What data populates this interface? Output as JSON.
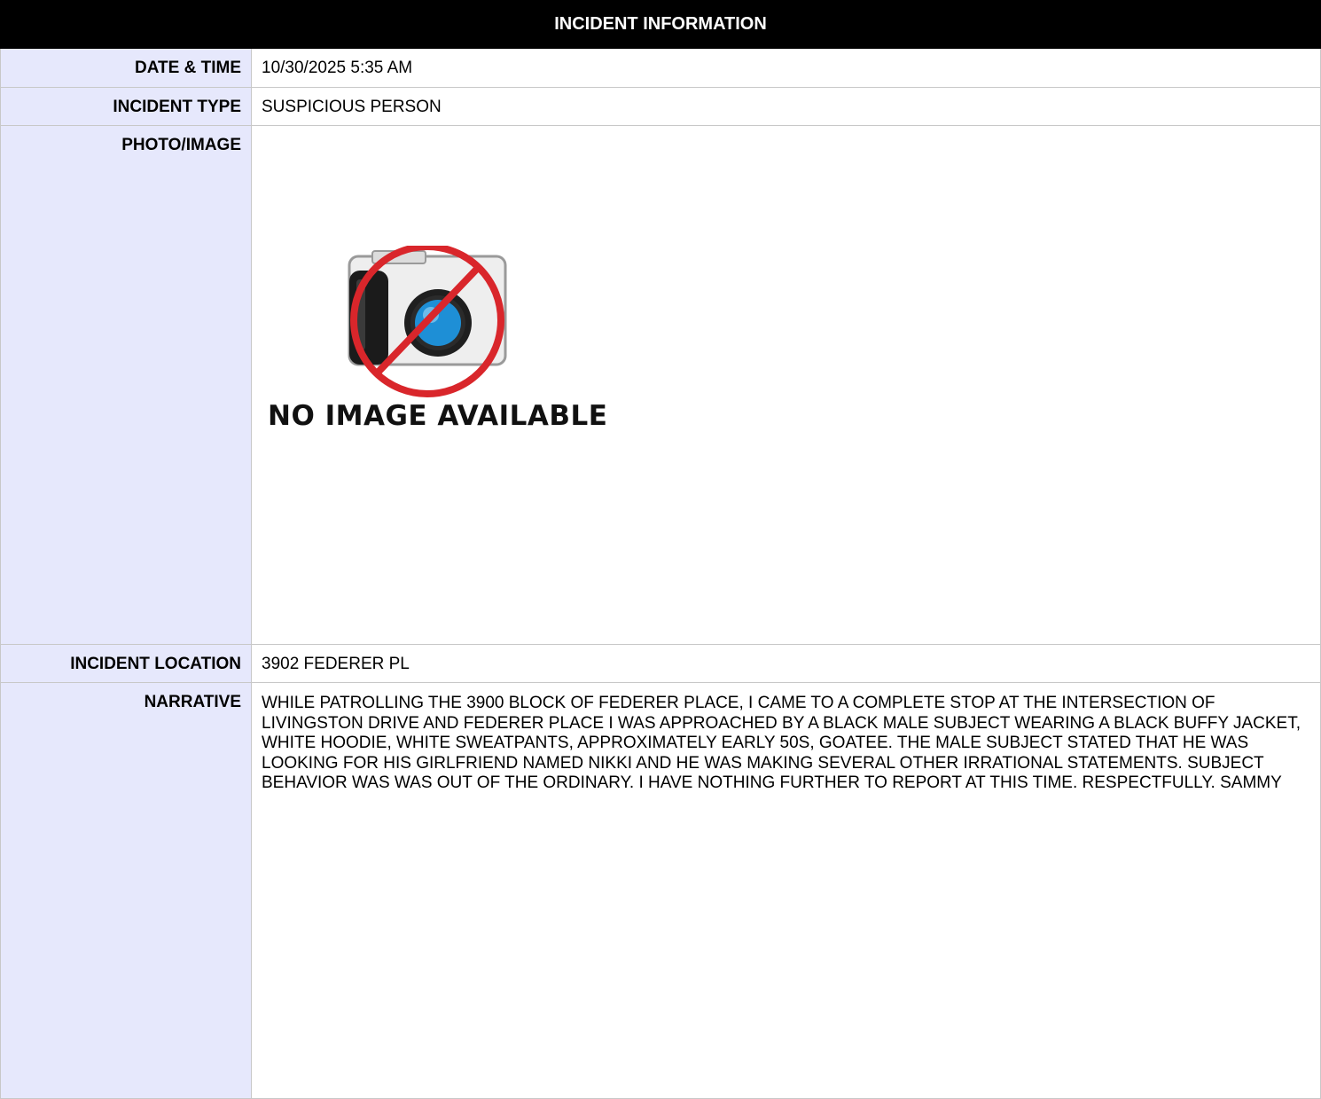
{
  "header": {
    "title": "INCIDENT INFORMATION"
  },
  "rows": {
    "date_time": {
      "label": "DATE & TIME",
      "value": "10/30/2025 5:35 AM"
    },
    "incident_type": {
      "label": "INCIDENT TYPE",
      "value": "SUSPICIOUS PERSON"
    },
    "photo": {
      "label": "PHOTO/IMAGE",
      "placeholder_text": "NO IMAGE AVAILABLE",
      "placeholder_icon": "no-camera-icon"
    },
    "location": {
      "label": "INCIDENT LOCATION",
      "value": "3902 FEDERER PL"
    },
    "narrative": {
      "label": "NARRATIVE",
      "value": "WHILE PATROLLING THE 3900 BLOCK OF FEDERER PLACE, I CAME TO A COMPLETE STOP AT THE INTERSECTION OF LIVINGSTON DRIVE AND FEDERER PLACE I WAS APPROACHED BY A BLACK MALE SUBJECT WEARING A BLACK BUFFY JACKET, WHITE HOODIE, WHITE SWEATPANTS, APPROXIMATELY EARLY 50S, GOATEE. THE MALE SUBJECT STATED THAT HE WAS LOOKING FOR HIS GIRLFRIEND NAMED NIKKI AND HE WAS MAKING SEVERAL OTHER IRRATIONAL STATEMENTS. SUBJECT BEHAVIOR WAS WAS OUT OF THE ORDINARY. I HAVE NOTHING FURTHER TO REPORT AT THIS TIME. RESPECTFULLY. SAMMY"
    }
  },
  "colors": {
    "header_bg": "#000000",
    "label_bg": "#e6e8fc",
    "border": "#c8c8c8",
    "prohibition_red": "#d9262b",
    "lens_blue": "#1e8fd6"
  }
}
